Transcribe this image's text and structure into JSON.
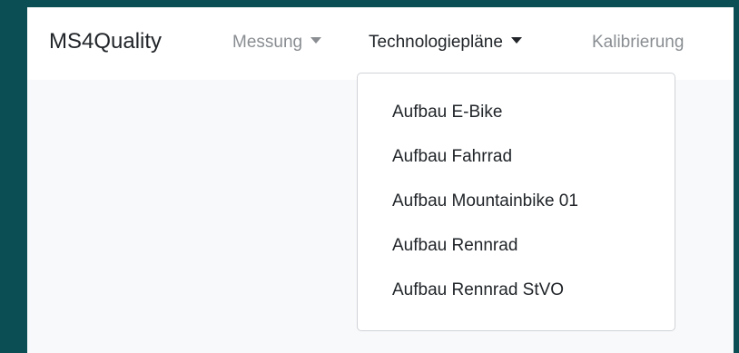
{
  "navbar": {
    "brand": "MS4Quality",
    "items": [
      {
        "label": "Messung",
        "has_caret": true,
        "active": false
      },
      {
        "label": "Technologiepläne",
        "has_caret": true,
        "active": true
      },
      {
        "label": "Kalibrierung",
        "has_caret": false,
        "active": false
      }
    ]
  },
  "dropdown": {
    "items": [
      {
        "label": "Aufbau E-Bike"
      },
      {
        "label": "Aufbau Fahrrad"
      },
      {
        "label": "Aufbau Mountainbike 01"
      },
      {
        "label": "Aufbau Rennrad"
      },
      {
        "label": "Aufbau Rennrad StVO"
      }
    ]
  },
  "colors": {
    "frame": "#0b4f55",
    "page_background": "#f8f9fa",
    "navbar_background": "#ffffff",
    "text_active": "#212529",
    "text_muted": "#8a8e92"
  },
  "icons": {
    "dropdown_caret": "caret-down-icon"
  }
}
